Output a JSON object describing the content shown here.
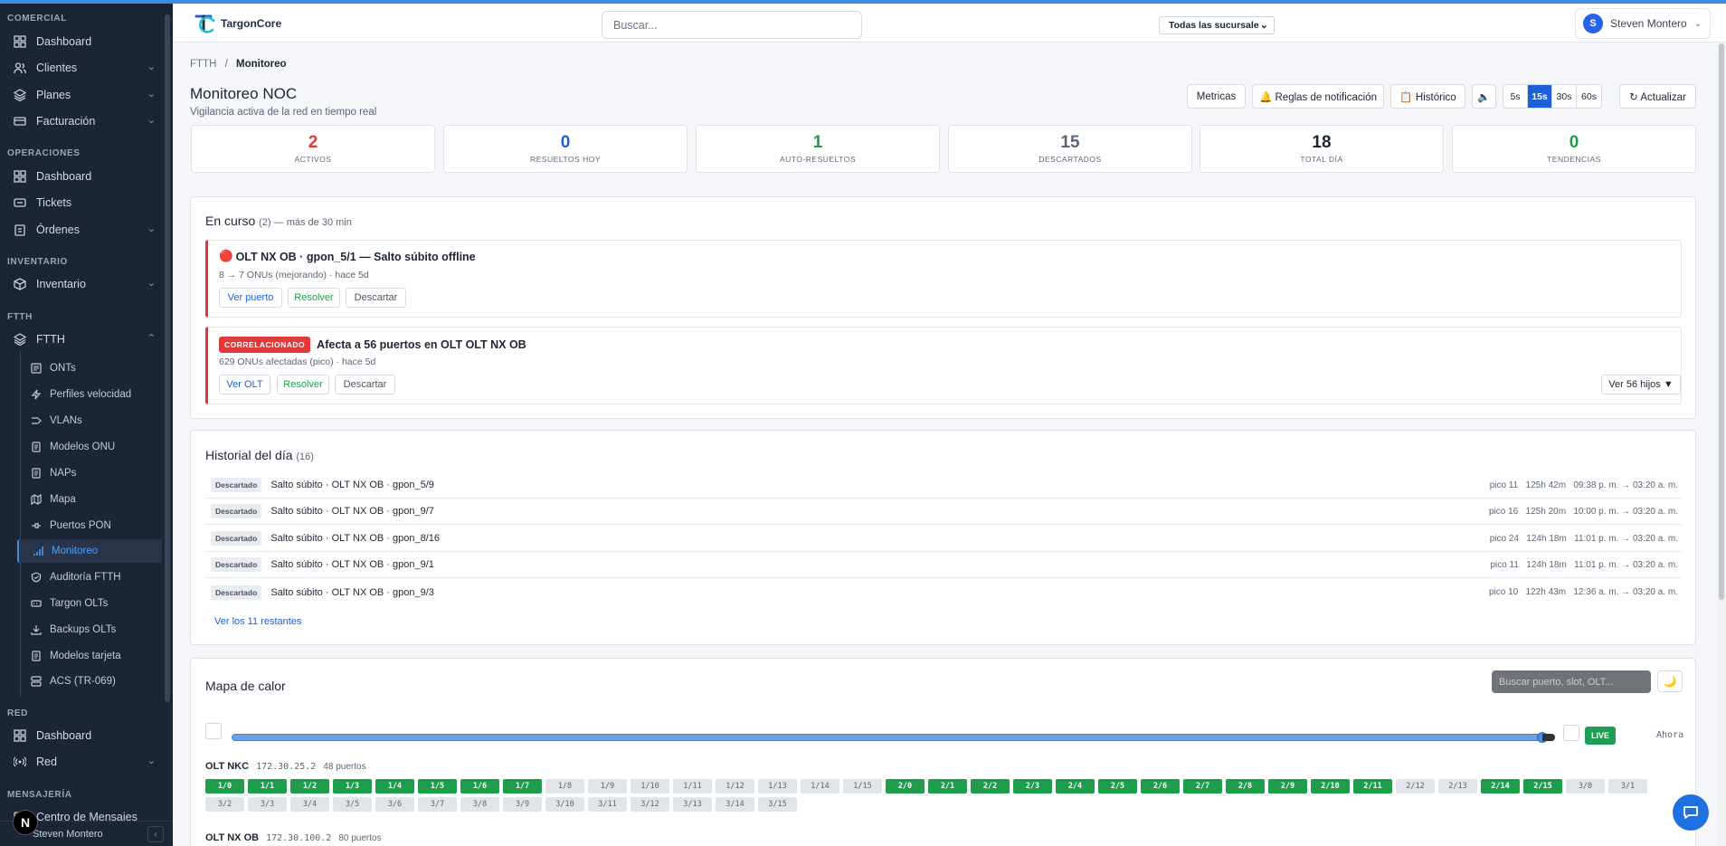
{
  "brand": {
    "name": "TargonCore",
    "accent": "#1d5fd6"
  },
  "sidebar": {
    "sections": [
      {
        "label": "COMERCIAL"
      },
      {
        "label": "OPERACIONES"
      },
      {
        "label": "INVENTARIO"
      },
      {
        "label": "FTTH"
      },
      {
        "label": "RED"
      },
      {
        "label": "MENSAJERÍA"
      }
    ],
    "items": {
      "c_dashboard": "Dashboard",
      "clientes": "Clientes",
      "planes": "Planes",
      "facturacion": "Facturación",
      "o_dashboard": "Dashboard",
      "tickets": "Tickets",
      "ordenes": "Órdenes",
      "inventario": "Inventario",
      "ftth": "FTTH",
      "r_dashboard": "Dashboard",
      "red": "Red",
      "centro": "Centro de Mensajes"
    },
    "ftth_sub": [
      "ONTs",
      "Perfiles velocidad",
      "VLANs",
      "Modelos ONU",
      "NAPs",
      "Mapa",
      "Puertos PON",
      "Monitoreo",
      "Auditoría FTTH",
      "Targon OLTs",
      "Backups OLTs",
      "Modelos tarjeta",
      "ACS (TR-069)"
    ],
    "bottom_user": "Steven Montero"
  },
  "header": {
    "search_placeholder": "Buscar...",
    "branch": "Todas las sucursale",
    "user_initial": "S",
    "user_name": "Steven Montero"
  },
  "breadcrumb": {
    "parent": "FTTH",
    "sep": "/",
    "current": "Monitoreo"
  },
  "page": {
    "title": "Monitoreo NOC",
    "subtitle": "Vigilancia activa de la red en tiempo real"
  },
  "toolbar": {
    "metricas": "Metricas",
    "reglas": "🔔 Reglas de notificación",
    "historico": "📋 Histórico",
    "sound": "🔈",
    "intervals": [
      "5s",
      "15s",
      "30s",
      "60s"
    ],
    "active_interval": "15s",
    "actualizar": "↻ Actualizar"
  },
  "stats": [
    {
      "value": "2",
      "label": "ACTIVOS",
      "color": "#e03b3b"
    },
    {
      "value": "0",
      "label": "RESUELTOS HOY",
      "color": "#1d5fd6"
    },
    {
      "value": "1",
      "label": "AUTO-RESUELTOS",
      "color": "#1e9e4a"
    },
    {
      "value": "15",
      "label": "DESCARTADOS",
      "color": "#5b6676"
    },
    {
      "value": "18",
      "label": "TOTAL DÍA",
      "color": "#1e2533"
    },
    {
      "value": "0",
      "label": "TENDENCIAS",
      "color": "#1e9e4a"
    }
  ],
  "en_curso": {
    "title": "En curso",
    "meta": "(2) — más de 30 min",
    "incidents": [
      {
        "icon": "🔴",
        "title": "OLT NX OB · gpon_5/1 — Salto súbito offline",
        "meta": "8 → 7 ONUs (mejorando) · hace 5d",
        "actions": [
          "Ver puerto",
          "Resolver",
          "Descartar"
        ]
      },
      {
        "badge": "CORRELACIONADO",
        "title": "Afecta a 56 puertos en OLT OLT NX OB",
        "meta": "629 ONUs afectadas (pico) · hace 5d",
        "actions": [
          "Ver OLT",
          "Resolver",
          "Descartar"
        ],
        "extra": "Ver 56 hijos ▼"
      }
    ]
  },
  "historial": {
    "title": "Historial del día",
    "count": "(16)",
    "rows": [
      {
        "tag": "Descartado",
        "text": "Salto súbito · OLT NX OB · gpon_5/9",
        "pico": "pico 11",
        "dur": "125h 42m",
        "range": "09:38 p. m. → 03:20 a. m."
      },
      {
        "tag": "Descartado",
        "text": "Salto súbito · OLT NX OB · gpon_9/7",
        "pico": "pico 16",
        "dur": "125h 20m",
        "range": "10:00 p. m. → 03:20 a. m."
      },
      {
        "tag": "Descartado",
        "text": "Salto súbito · OLT NX OB · gpon_8/16",
        "pico": "pico 24",
        "dur": "124h 18m",
        "range": "11:01 p. m. → 03:20 a. m."
      },
      {
        "tag": "Descartado",
        "text": "Salto súbito · OLT NX OB · gpon_9/1",
        "pico": "pico 11",
        "dur": "124h 18m",
        "range": "11:01 p. m. → 03:20 a. m."
      },
      {
        "tag": "Descartado",
        "text": "Salto súbito · OLT NX OB · gpon_9/3",
        "pico": "pico 10",
        "dur": "122h 43m",
        "range": "12:36 a. m. → 03:20 a. m."
      }
    ],
    "more": "Ver los 11 restantes"
  },
  "heatmap": {
    "title": "Mapa de calor",
    "search_placeholder": "Buscar puerto, slot, OLT...",
    "theme_icon": "🌙",
    "live": "LIVE",
    "now": "Ahora",
    "olt1": {
      "name": "OLT NKC",
      "ip": "172.30.25.2",
      "ports_count": "48 puertos"
    },
    "olt2": {
      "name": "OLT NX OB",
      "ip": "172.30.100.2",
      "ports_count": "80 puertos"
    },
    "ports": [
      {
        "l": "1/0",
        "s": "g"
      },
      {
        "l": "1/1",
        "s": "g"
      },
      {
        "l": "1/2",
        "s": "g"
      },
      {
        "l": "1/3",
        "s": "g"
      },
      {
        "l": "1/4",
        "s": "g"
      },
      {
        "l": "1/5",
        "s": "g"
      },
      {
        "l": "1/6",
        "s": "g"
      },
      {
        "l": "1/7",
        "s": "g"
      },
      {
        "l": "1/8",
        "s": "n"
      },
      {
        "l": "1/9",
        "s": "n"
      },
      {
        "l": "1/10",
        "s": "n"
      },
      {
        "l": "1/11",
        "s": "n"
      },
      {
        "l": "1/12",
        "s": "n"
      },
      {
        "l": "1/13",
        "s": "n"
      },
      {
        "l": "1/14",
        "s": "n"
      },
      {
        "l": "1/15",
        "s": "n"
      },
      {
        "l": "2/0",
        "s": "g"
      },
      {
        "l": "2/1",
        "s": "g"
      },
      {
        "l": "2/2",
        "s": "g"
      },
      {
        "l": "2/3",
        "s": "g"
      },
      {
        "l": "2/4",
        "s": "g"
      },
      {
        "l": "2/5",
        "s": "g"
      },
      {
        "l": "2/6",
        "s": "g"
      },
      {
        "l": "2/7",
        "s": "g"
      },
      {
        "l": "2/8",
        "s": "g"
      },
      {
        "l": "2/9",
        "s": "g"
      },
      {
        "l": "2/10",
        "s": "g"
      },
      {
        "l": "2/11",
        "s": "g"
      },
      {
        "l": "2/12",
        "s": "n"
      },
      {
        "l": "2/13",
        "s": "n"
      },
      {
        "l": "2/14",
        "s": "g"
      },
      {
        "l": "2/15",
        "s": "g"
      },
      {
        "l": "3/0",
        "s": "n"
      },
      {
        "l": "3/1",
        "s": "n"
      },
      {
        "l": "3/2",
        "s": "n"
      },
      {
        "l": "3/3",
        "s": "n"
      },
      {
        "l": "3/4",
        "s": "n"
      },
      {
        "l": "3/5",
        "s": "n"
      },
      {
        "l": "3/6",
        "s": "n"
      },
      {
        "l": "3/7",
        "s": "n"
      },
      {
        "l": "3/8",
        "s": "n"
      },
      {
        "l": "3/9",
        "s": "n"
      },
      {
        "l": "3/10",
        "s": "n"
      },
      {
        "l": "3/11",
        "s": "n"
      },
      {
        "l": "3/12",
        "s": "n"
      },
      {
        "l": "3/13",
        "s": "n"
      },
      {
        "l": "3/14",
        "s": "n"
      },
      {
        "l": "3/15",
        "s": "n"
      }
    ]
  },
  "corner_badge": "N"
}
